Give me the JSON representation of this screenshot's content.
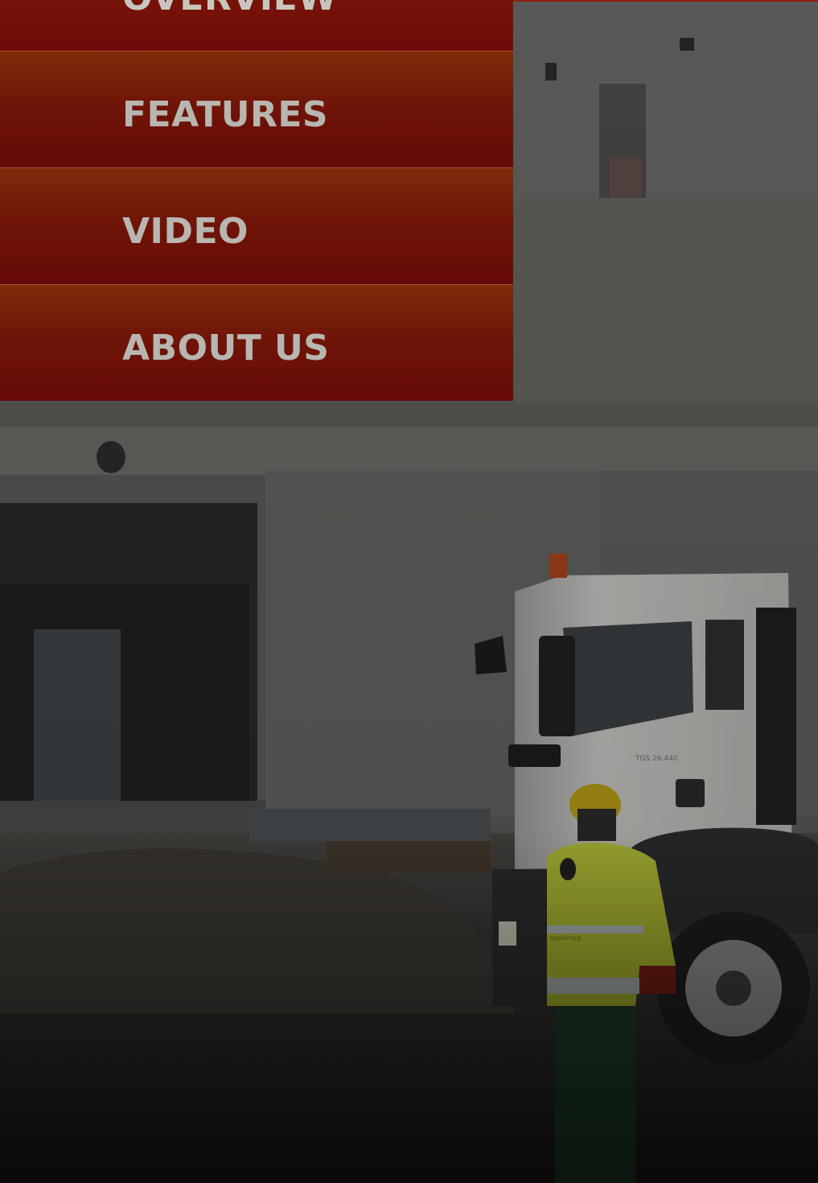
{
  "nav": {
    "items": [
      {
        "label": "OVERVIEW"
      },
      {
        "label": "FEATURES"
      },
      {
        "label": "VIDEO"
      },
      {
        "label": "ABOUT US"
      }
    ]
  },
  "colors": {
    "menu_background": "#6f1208",
    "menu_label": "#b8b6b0",
    "menu_divider": "#a4552b"
  },
  "hero": {
    "truck_model_text": "TGS 26.440",
    "vest_text": "spedimag"
  }
}
